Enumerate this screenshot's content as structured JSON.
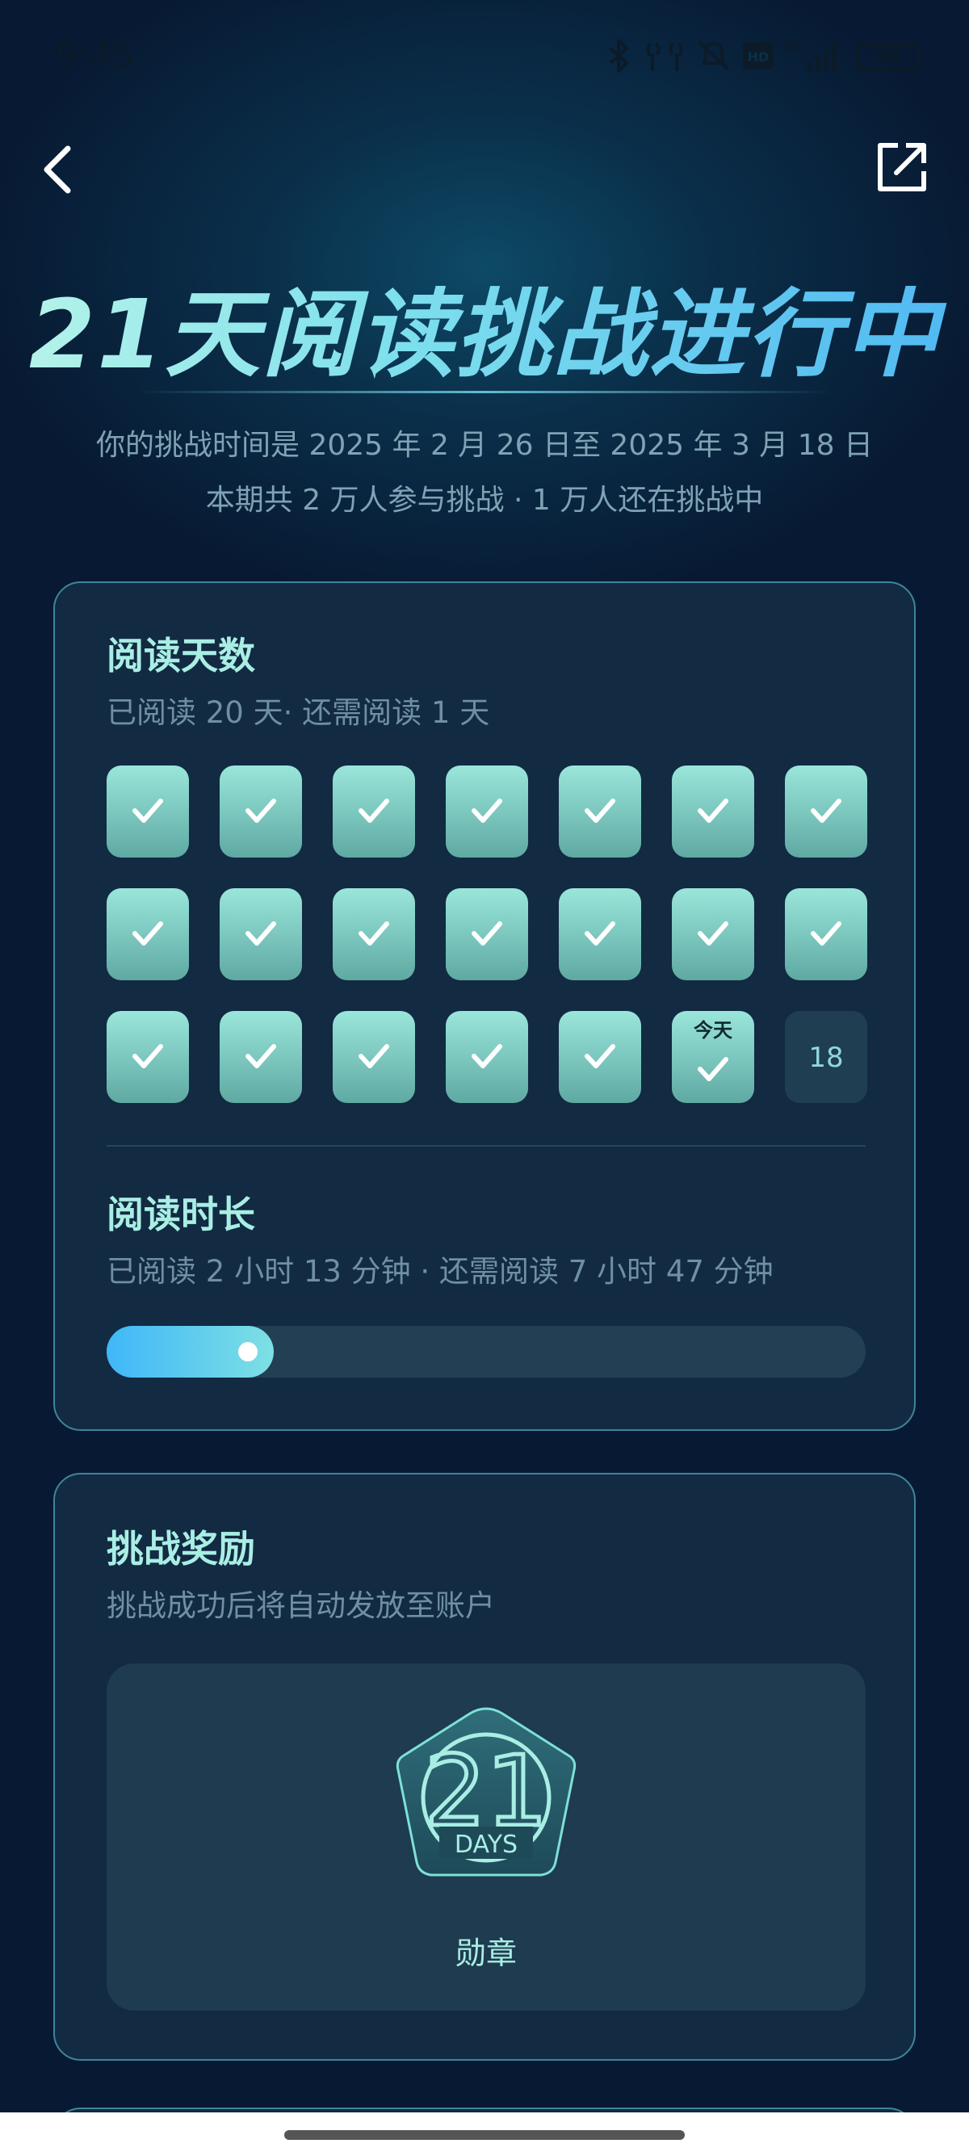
{
  "status_bar": {
    "time": "9:45",
    "battery": "96"
  },
  "header": {
    "title": "21天阅读挑战进行中",
    "subtitle_line1": "你的挑战时间是 2025 年 2 月 26 日至 2025 年 3 月 18 日",
    "subtitle_line2": "本期共 2 万人参与挑战 · 1 万人还在挑战中"
  },
  "reading_days": {
    "title": "阅读天数",
    "summary": "已阅读 20 天· 还需阅读 1 天",
    "days_total": 21,
    "days_done": 20,
    "today_label": "今天",
    "pending_day_number": "18"
  },
  "reading_time": {
    "title": "阅读时长",
    "summary": "已阅读 2 小时 13 分钟 · 还需阅读 7 小时 47 分钟",
    "progress_fraction": 0.22
  },
  "reward": {
    "title": "挑战奖励",
    "subtitle": "挑战成功后将自动发放至账户",
    "medal_number": "21",
    "medal_text": "DAYS",
    "medal_label": "勋章"
  },
  "colors": {
    "background": "#081a33",
    "accent_teal": "#9ae6da",
    "accent_blue": "#3fb7f8",
    "title_text": "#a9eee4",
    "muted_text": "#6f90a2"
  },
  "icons": [
    "back-icon",
    "share-icon",
    "bluetooth-icon",
    "earbuds-icon",
    "mute-icon",
    "hd-icon",
    "signal-icon",
    "battery-icon",
    "check-icon",
    "medal-icon"
  ]
}
